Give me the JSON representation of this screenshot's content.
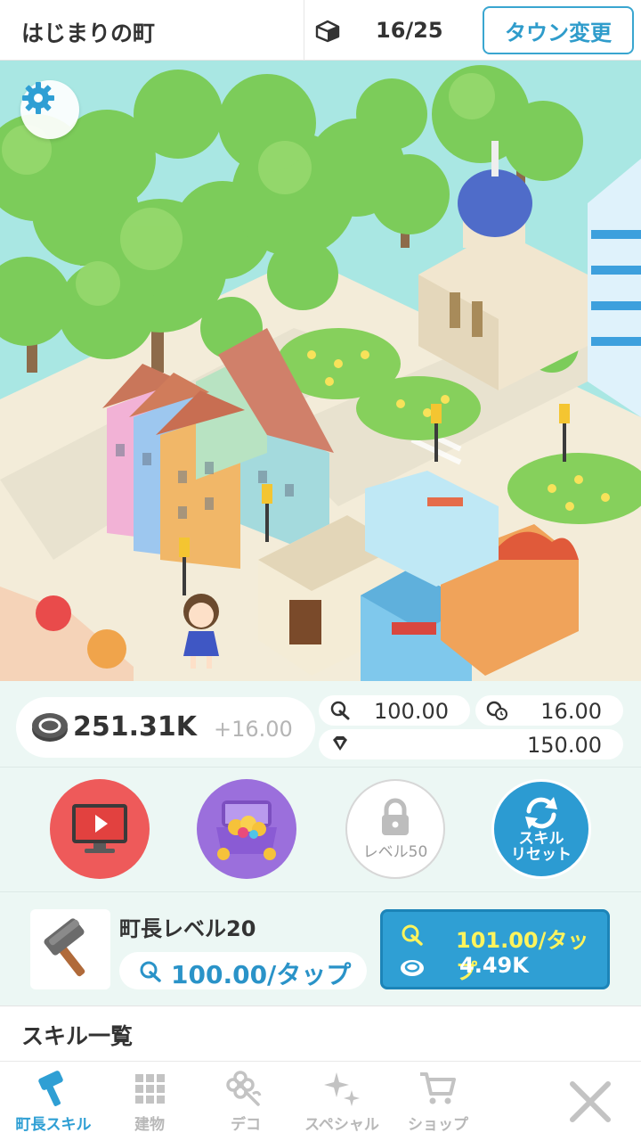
{
  "header": {
    "town_name": "はじまりの町",
    "progress": "16/25",
    "town_change_label": "タウン変更"
  },
  "resources": {
    "coins": "251.31K",
    "coin_gain": "+16.00",
    "tap_income": "100.00",
    "auto_income": "16.00",
    "gems": "150.00"
  },
  "actions": {
    "locked_label": "レベル50",
    "reset_label_line1": "スキル",
    "reset_label_line2": "リセット"
  },
  "skill": {
    "mayor_level": "町長レベル20",
    "current_per_tap": "100.00/タップ",
    "next_per_tap": "101.00/タップ",
    "upgrade_cost": "4.49K"
  },
  "skill_list_title": "スキル一覧",
  "nav": {
    "items": [
      {
        "label": "町長スキル",
        "icon": "hammer-icon",
        "active": true
      },
      {
        "label": "建物",
        "icon": "grid-icon",
        "active": false
      },
      {
        "label": "デコ",
        "icon": "flower-icon",
        "active": false
      },
      {
        "label": "スペシャル",
        "icon": "sparkle-icon",
        "active": false
      },
      {
        "label": "ショップ",
        "icon": "cart-icon",
        "active": false
      }
    ]
  },
  "colors": {
    "accent_blue": "#2f9fd4",
    "highlight_yellow": "#fff45c",
    "video_red": "#ee5a5a",
    "chest_purple": "#9b6fdc"
  }
}
